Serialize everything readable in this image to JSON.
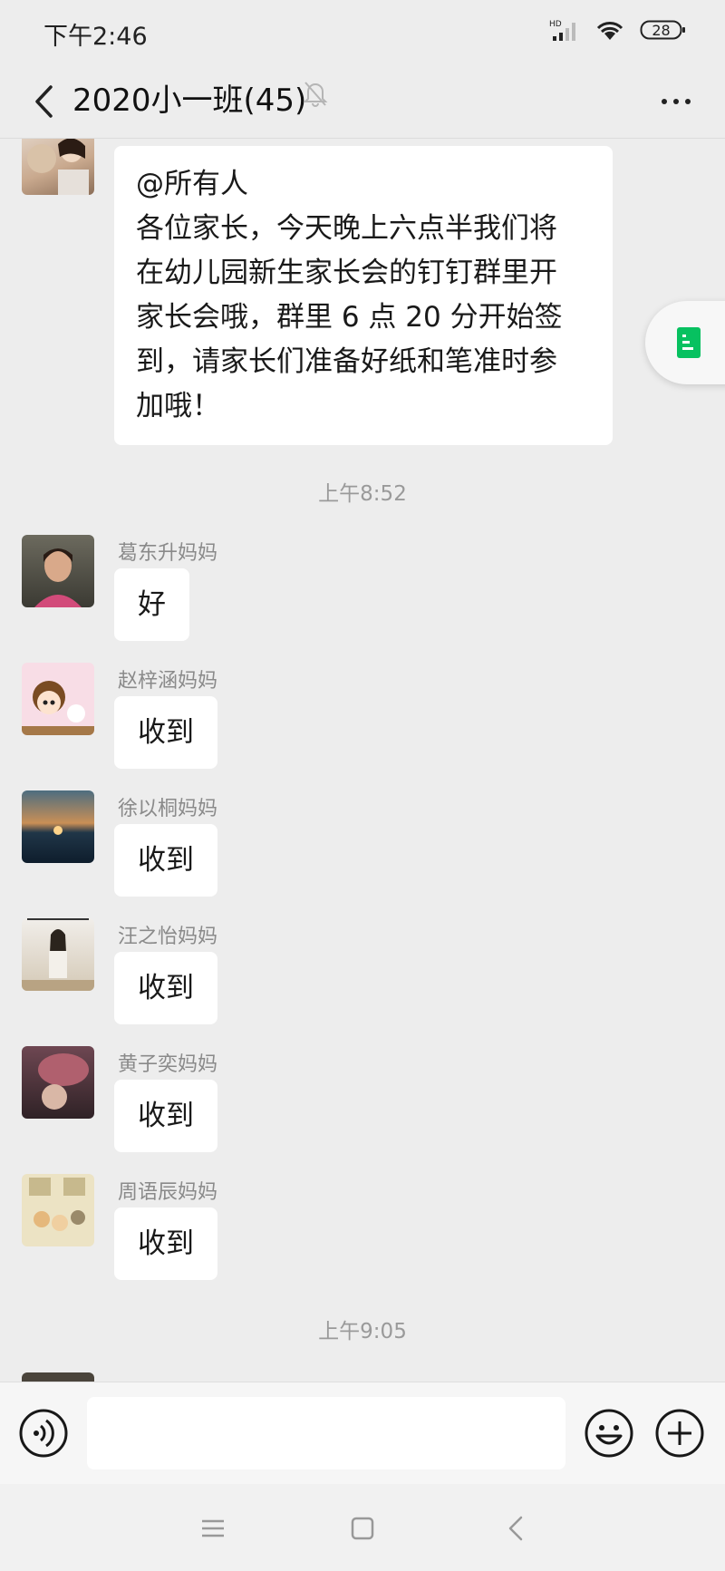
{
  "status_bar": {
    "time": "下午2:46",
    "battery": "28",
    "network_label": "HD"
  },
  "header": {
    "title": "2020小一班(45)"
  },
  "messages": [
    {
      "type": "announcement",
      "lines": [
        "@所有人",
        "各位家长，今天晚上六点半我们将",
        "在幼儿园新生家长会的钉钉群里开",
        "家长会哦，群里 6 点 20 分开始签",
        "到，请家长们准备好纸和笔准时参",
        "加哦！"
      ]
    },
    {
      "type": "timestamp",
      "text": "上午8:52"
    },
    {
      "type": "message",
      "sender": "葛东升妈妈",
      "text": "好"
    },
    {
      "type": "message",
      "sender": "赵梓涵妈妈",
      "text": "收到"
    },
    {
      "type": "message",
      "sender": "徐以桐妈妈",
      "text": "收到"
    },
    {
      "type": "message",
      "sender": "汪之怡妈妈",
      "text": "收到"
    },
    {
      "type": "message",
      "sender": "黄子奕妈妈",
      "text": "收到"
    },
    {
      "type": "message",
      "sender": "周语辰妈妈",
      "text": "收到"
    },
    {
      "type": "timestamp",
      "text": "上午9:05"
    }
  ],
  "input": {
    "placeholder": ""
  },
  "icons": {
    "back": "chevron-left-icon",
    "mute": "bell-off-icon",
    "more": "more-dots-icon",
    "voice": "voice-icon",
    "emoji": "emoji-icon",
    "plus": "plus-icon",
    "doc": "document-icon"
  },
  "colors": {
    "background": "#ededed",
    "bubble": "#ffffff",
    "accent_green": "#07c160"
  }
}
